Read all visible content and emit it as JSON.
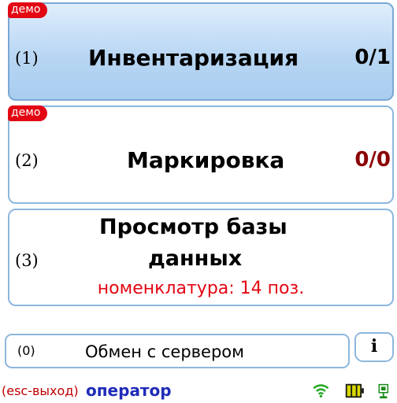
{
  "tiles": [
    {
      "demo": "демо",
      "num": "(1)",
      "title": "Инвентаризация",
      "count": "0/1",
      "count_color": "#000000"
    },
    {
      "demo": "демо",
      "num": "(2)",
      "title": "Маркировка",
      "count": "0/0",
      "count_color": "#8b0000"
    },
    {
      "num": "(3)",
      "title_line1": "Просмотр базы",
      "title_line2": "данных",
      "subtitle": "номенклатура: 14 поз."
    }
  ],
  "exchange": {
    "num": "(0)",
    "label": "Обмен с сервером"
  },
  "info_button": "i",
  "status": {
    "esc": "(esc-выход)",
    "user": "оператор",
    "icons": [
      "wifi-icon",
      "battery-icon",
      "network-icon"
    ]
  },
  "colors": {
    "accent_border": "#8db7de",
    "demo_badge": "#e30613",
    "user_text": "#1f2bb8"
  }
}
